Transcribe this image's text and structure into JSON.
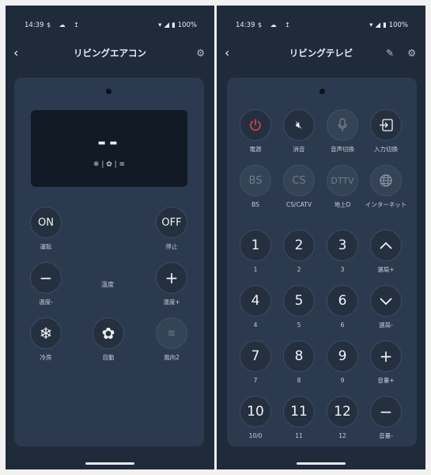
{
  "left_screen": {
    "status": {
      "time": "14:39",
      "icons": "$ ☁ ↥",
      "battery": "100%"
    },
    "appbar": {
      "back": "‹",
      "title": "リビングエアコン",
      "settings_icon": "gear-icon"
    },
    "display": {
      "temp": "--",
      "modes": "❄ | ✿ | ≋"
    },
    "buttons": {
      "on": {
        "text": "ON",
        "label": "運転"
      },
      "off": {
        "text": "OFF",
        "label": "停止"
      },
      "temp_down": {
        "label": "温度-"
      },
      "temp_up": {
        "label": "温度+"
      },
      "temp_caption": "温度",
      "cool": {
        "label": "冷房"
      },
      "auto": {
        "label": "自動"
      },
      "wind": {
        "label": "風向2"
      }
    }
  },
  "right_screen": {
    "status": {
      "time": "14:39",
      "icons": "$ ☁ ↥",
      "battery": "100%"
    },
    "appbar": {
      "back": "‹",
      "title": "リビングテレビ",
      "edit_icon": "pencil-icon",
      "settings_icon": "gear-icon"
    },
    "buttons": {
      "power": {
        "label": "電源"
      },
      "mute": {
        "label": "消音"
      },
      "voice": {
        "label": "音声切換"
      },
      "input": {
        "label": "入力切換"
      },
      "bs": {
        "text": "BS",
        "label": "BS"
      },
      "cs": {
        "text": "CS",
        "label": "CS/CATV"
      },
      "dttv": {
        "text": "DTTV",
        "label": "地上D"
      },
      "internet": {
        "label": "インターネット"
      },
      "n1": {
        "text": "1",
        "label": "1"
      },
      "n2": {
        "text": "2",
        "label": "2"
      },
      "n3": {
        "text": "3",
        "label": "3"
      },
      "ch_up": {
        "label": "選局+"
      },
      "n4": {
        "text": "4",
        "label": "4"
      },
      "n5": {
        "text": "5",
        "label": "5"
      },
      "n6": {
        "text": "6",
        "label": "6"
      },
      "ch_down": {
        "label": "選局-"
      },
      "n7": {
        "text": "7",
        "label": "7"
      },
      "n8": {
        "text": "8",
        "label": "8"
      },
      "n9": {
        "text": "9",
        "label": "9"
      },
      "vol_up": {
        "label": "音量+"
      },
      "n10": {
        "text": "10",
        "label": "10/0"
      },
      "n11": {
        "text": "11",
        "label": "11"
      },
      "n12": {
        "text": "12",
        "label": "12"
      },
      "vol_down": {
        "label": "音量-"
      }
    }
  },
  "colors": {
    "background": "#1f2a3b",
    "panel": "#2c3a4f",
    "power_red": "#e0444a"
  }
}
